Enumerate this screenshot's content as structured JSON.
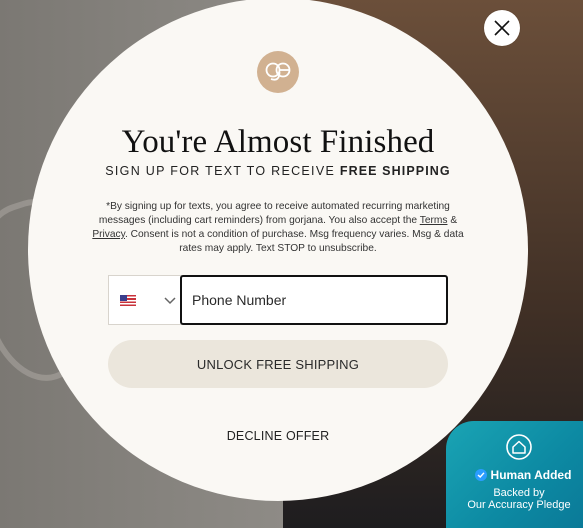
{
  "modal": {
    "title": "You're Almost Finished",
    "subtitle_prefix": "SIGN UP FOR TEXT TO RECEIVE ",
    "subtitle_bold": "FREE SHIPPING",
    "legal": {
      "part1": "*By signing up for texts, you agree to receive automated recurring marketing messages (including cart reminders) from gorjana. You also accept the ",
      "terms_link": "Terms",
      "amp": " & ",
      "privacy_link": "Privacy",
      "part2": ". Consent is not a condition of purchase. Msg frequency varies. Msg & data rates may apply. Text STOP to unsubscribe."
    },
    "phone": {
      "country_flag": "us-flag-icon",
      "placeholder": "Phone Number"
    },
    "unlock_label": "UNLOCK FREE SHIPPING",
    "decline_label": "DECLINE OFFER",
    "close_icon": "close-icon",
    "logo_icon": "gorjana-logo"
  },
  "badge": {
    "title": "Human Added",
    "line1": "Backed by",
    "line2": "Our Accuracy Pledge"
  },
  "colors": {
    "modal_bg": "#faf8f4",
    "logo": "#d1b191",
    "button_bg": "#ebe6dc",
    "badge_bg": "#0d8aa3"
  }
}
